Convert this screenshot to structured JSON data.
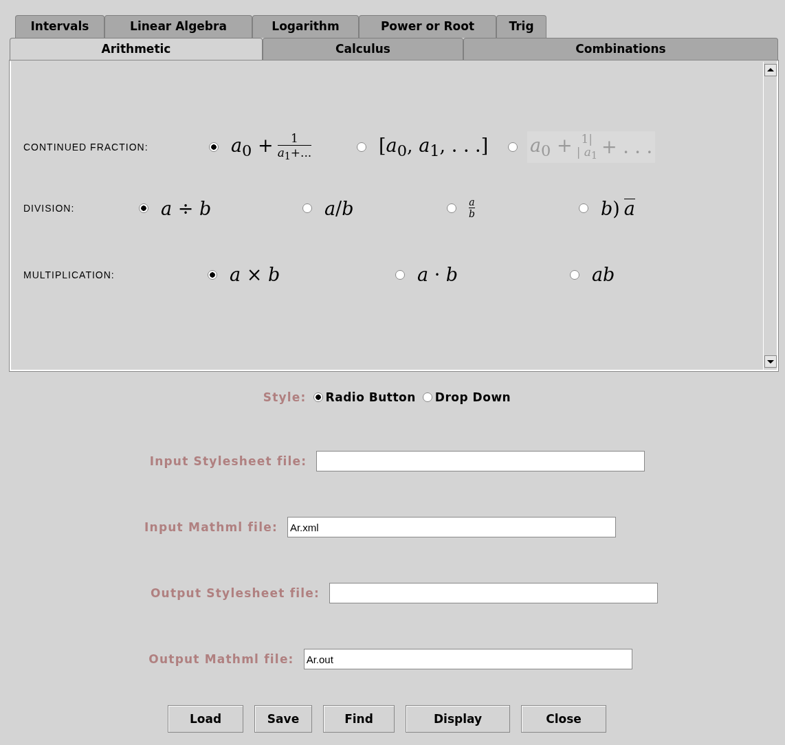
{
  "tabs_top": [
    {
      "label": "Intervals",
      "selected": false
    },
    {
      "label": "Linear Algebra",
      "selected": false
    },
    {
      "label": "Logarithm",
      "selected": false
    },
    {
      "label": "Power or Root",
      "selected": false
    },
    {
      "label": "Trig",
      "selected": false
    }
  ],
  "tabs_bottom": [
    {
      "label": "Arithmetic",
      "selected": true
    },
    {
      "label": "Calculus",
      "selected": false
    },
    {
      "label": "Combinations",
      "selected": false
    }
  ],
  "settings": [
    {
      "label": "CONTINUED FRACTION:",
      "options": [
        {
          "kind": "fraction",
          "before": "*a*$_{0}$ +",
          "numerator": "1",
          "denominator": "*a*$_{1}$+...",
          "selected": true,
          "dimmed": false
        },
        {
          "kind": "inline",
          "text": "[*a*$_{0}$, *a*$_{1}$, . . .]",
          "selected": false,
          "dimmed": false
        },
        {
          "kind": "fraction",
          "before": "*a*$_{0}$ +",
          "numerator": "1|",
          "denominator": "| *a*$_{1}$",
          "after": "+ . . .",
          "selected": false,
          "dimmed": true
        }
      ]
    },
    {
      "label": "DIVISION:",
      "options": [
        {
          "kind": "inline",
          "text": "*a* ÷ *b*",
          "selected": true,
          "dimmed": false
        },
        {
          "kind": "inline",
          "text": "*a*/*b*",
          "selected": false,
          "dimmed": false
        },
        {
          "kind": "fraction",
          "numerator": "*a*",
          "denominator": "*b*",
          "selected": false,
          "dimmed": false
        },
        {
          "kind": "longdiv",
          "divisor": "*b*)",
          "dividend": "*a*",
          "selected": false,
          "dimmed": false
        }
      ]
    },
    {
      "label": "MULTIPLICATION:",
      "options": [
        {
          "kind": "inline",
          "text": "*a* × *b*",
          "selected": true,
          "dimmed": false
        },
        {
          "kind": "inline",
          "text": "*a* · *b*",
          "selected": false,
          "dimmed": false
        },
        {
          "kind": "inline",
          "text": "*ab*",
          "selected": false,
          "dimmed": false
        }
      ]
    }
  ],
  "style": {
    "label": "Style:",
    "options": [
      {
        "label": "Radio Button",
        "selected": true
      },
      {
        "label": "Drop Down",
        "selected": false
      }
    ]
  },
  "files": [
    {
      "label": "Input Stylesheet file:"
    },
    {
      "label": "Input Mathml file:",
      "value": "Ar.xml"
    },
    {
      "label": "Output Stylesheet file:"
    },
    {
      "label": "Output Mathml file:",
      "value": "Ar.out"
    }
  ],
  "buttons": [
    "Load",
    "Save",
    "Find",
    "Display",
    "Close"
  ]
}
